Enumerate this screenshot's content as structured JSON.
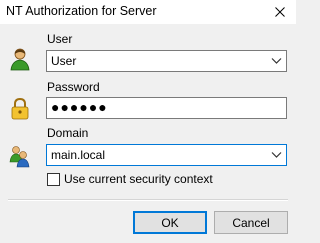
{
  "window": {
    "title": "NT Authorization for Server",
    "close_label": "close"
  },
  "form": {
    "user": {
      "label": "User",
      "value": "User"
    },
    "password": {
      "label": "Password",
      "value": "●●●●●●"
    },
    "domain": {
      "label": "Domain",
      "value": "main.local"
    },
    "security_context": {
      "label": "Use current security context",
      "checked": false
    }
  },
  "buttons": {
    "ok_label": "OK",
    "cancel_label": "Cancel"
  },
  "icons": {
    "user": "user-icon",
    "password": "padlock-icon",
    "domain": "users-group-icon",
    "close": "close-icon",
    "dropdown": "chevron-down-icon"
  },
  "colors": {
    "focus_border": "#0078d7",
    "window_bg": "#f0f0f0"
  }
}
